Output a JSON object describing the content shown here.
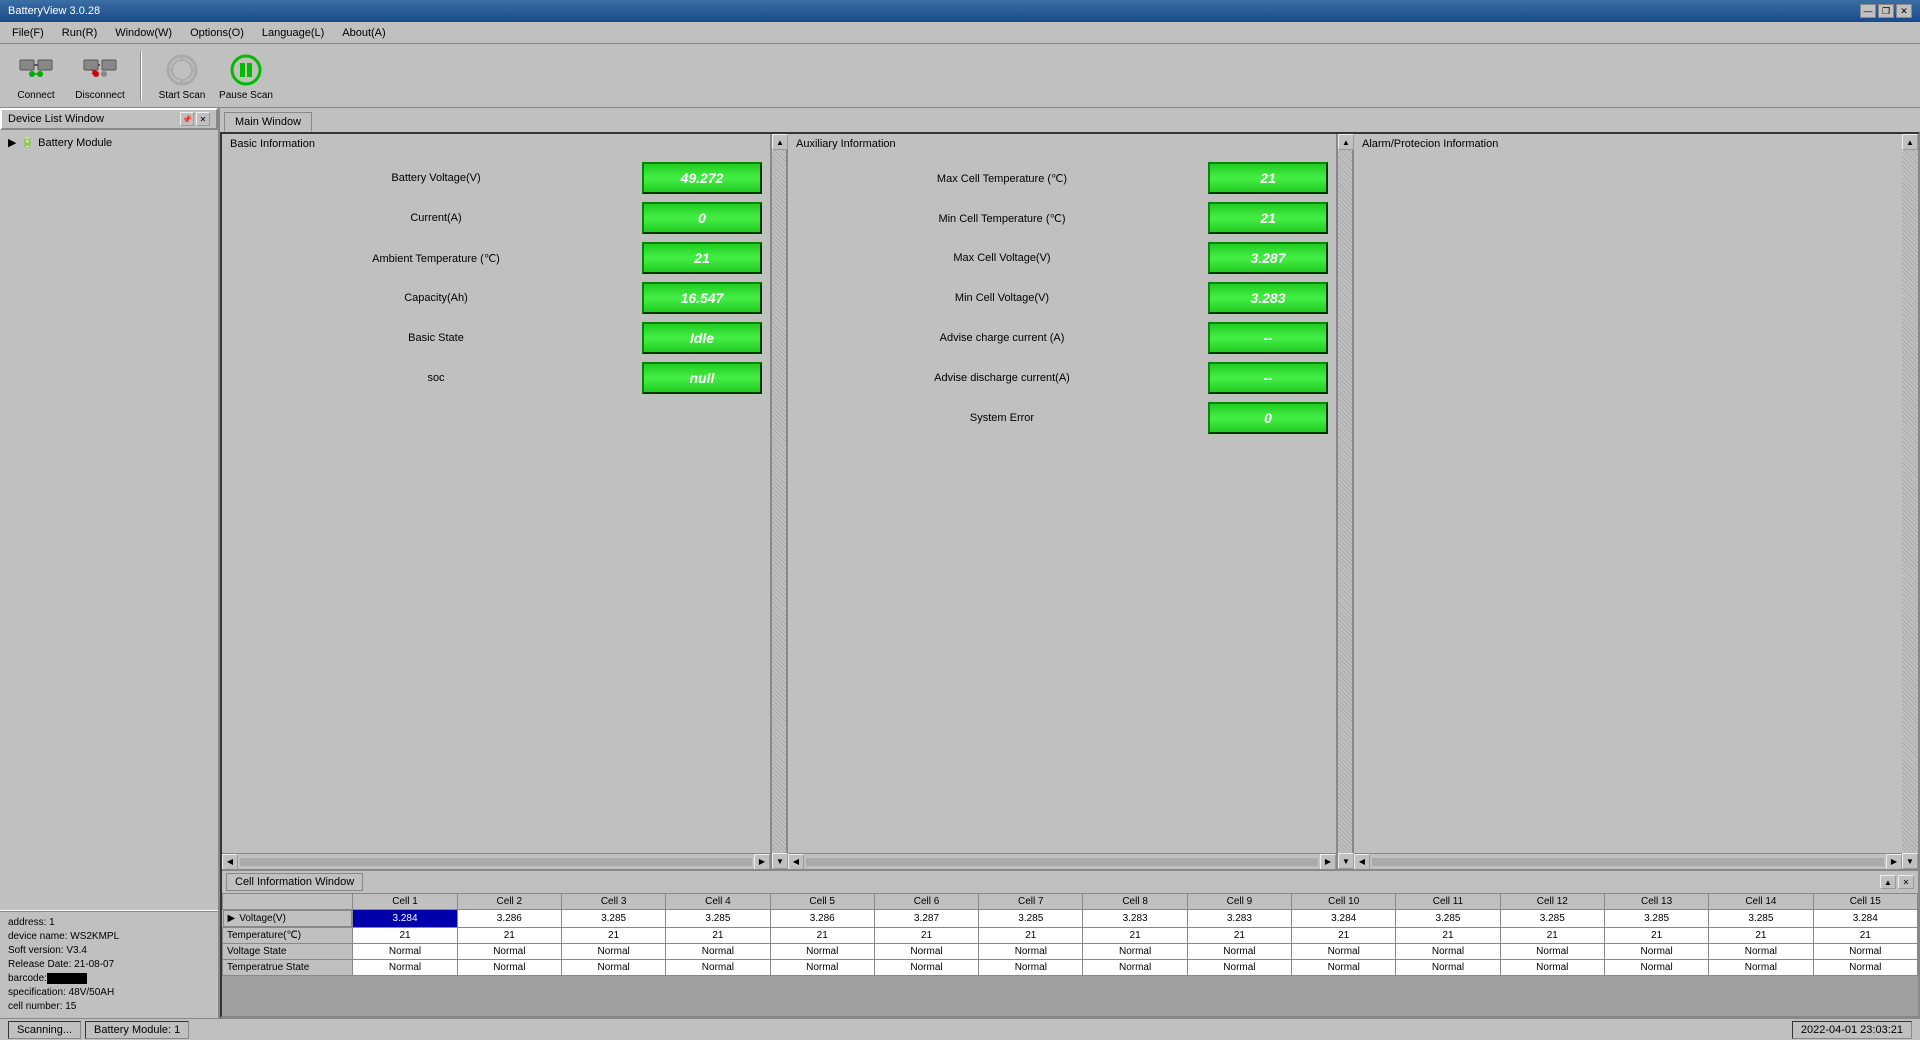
{
  "app": {
    "title": "BatteryView 3.0.28",
    "version": "3.0.28"
  },
  "titlebar": {
    "minimize_label": "—",
    "restore_label": "❐",
    "close_label": "✕"
  },
  "menubar": {
    "items": [
      {
        "label": "File(F)"
      },
      {
        "label": "Run(R)"
      },
      {
        "label": "Window(W)"
      },
      {
        "label": "Options(O)"
      },
      {
        "label": "Language(L)"
      },
      {
        "label": "About(A)"
      }
    ]
  },
  "toolbar": {
    "connect_label": "Connect",
    "disconnect_label": "Disconnect",
    "start_scan_label": "Start Scan",
    "pause_scan_label": "Pause Scan"
  },
  "device_list": {
    "title": "Device List Window",
    "battery_module_label": "Battery Module"
  },
  "device_info": {
    "address": "address: 1",
    "device_name": "device name: WS2KMPL",
    "soft_version": "Soft version: V3.4",
    "release_date": "Release Date: 21-08-07",
    "barcode": "barcode:",
    "specification": "specification: 48V/50AH",
    "cell_number": "cell number: 15"
  },
  "main_window": {
    "tab_label": "Main Window",
    "sections": {
      "basic_info": {
        "title": "Basic Information",
        "fields": [
          {
            "label": "Battery Voltage(V)",
            "value": "49.272"
          },
          {
            "label": "Current(A)",
            "value": "0"
          },
          {
            "label": "Ambient Temperature (℃)",
            "value": "21"
          },
          {
            "label": "Capacity(Ah)",
            "value": "16.547"
          },
          {
            "label": "Basic State",
            "value": "Idle"
          },
          {
            "label": "soc",
            "value": "null"
          }
        ]
      },
      "auxiliary_info": {
        "title": "Auxiliary Information",
        "fields": [
          {
            "label": "Max Cell Temperature (℃)",
            "value": "21"
          },
          {
            "label": "Min Cell Temperature (℃)",
            "value": "21"
          },
          {
            "label": "Max Cell Voltage(V)",
            "value": "3.287"
          },
          {
            "label": "Min Cell Voltage(V)",
            "value": "3.283"
          },
          {
            "label": "Advise charge current (A)",
            "value": "--"
          },
          {
            "label": "Advise discharge current(A)",
            "value": "--"
          },
          {
            "label": "System Error",
            "value": "0"
          }
        ]
      },
      "alarm_info": {
        "title": "Alarm/Protecion Information"
      }
    }
  },
  "cell_window": {
    "title": "Cell Information Window",
    "columns": [
      "",
      "Cell 1",
      "Cell 2",
      "Cell 3",
      "Cell 4",
      "Cell 5",
      "Cell 6",
      "Cell 7",
      "Cell 8",
      "Cell 9",
      "Cell 10",
      "Cell 11",
      "Cell 12",
      "Cell 13",
      "Cell 14",
      "Cell 15"
    ],
    "rows": [
      {
        "label": "Voltage(V)",
        "values": [
          "3.284",
          "3.286",
          "3.285",
          "3.285",
          "3.286",
          "3.287",
          "3.285",
          "3.283",
          "3.283",
          "3.284",
          "3.285",
          "3.285",
          "3.285",
          "3.285",
          "3.284"
        ],
        "selected_col": 0
      },
      {
        "label": "Temperature(℃)",
        "values": [
          "21",
          "21",
          "21",
          "21",
          "21",
          "21",
          "21",
          "21",
          "21",
          "21",
          "21",
          "21",
          "21",
          "21",
          "21"
        ]
      },
      {
        "label": "Voltage State",
        "values": [
          "Normal",
          "Normal",
          "Normal",
          "Normal",
          "Normal",
          "Normal",
          "Normal",
          "Normal",
          "Normal",
          "Normal",
          "Normal",
          "Normal",
          "Normal",
          "Normal",
          "Normal"
        ]
      },
      {
        "label": "Temperatrue State",
        "values": [
          "Normal",
          "Normal",
          "Normal",
          "Normal",
          "Normal",
          "Normal",
          "Normal",
          "Normal",
          "Normal",
          "Normal",
          "Normal",
          "Normal",
          "Normal",
          "Normal",
          "Normal"
        ]
      }
    ]
  },
  "statusbar": {
    "scanning_label": "Scanning...",
    "battery_module_label": "Battery Module: 1",
    "datetime": "2022-04-01 23:03:21"
  }
}
